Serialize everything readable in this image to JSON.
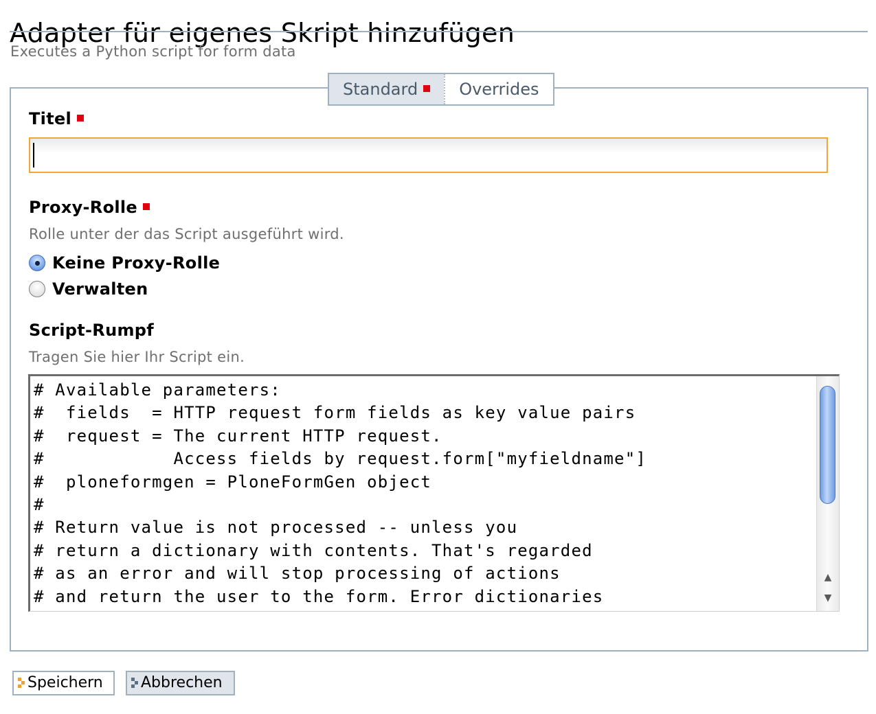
{
  "page": {
    "title": "Adapter für eigenes Skript hinzufügen",
    "description": "Executes a Python script for form data"
  },
  "tabs": [
    {
      "label": "Standard",
      "selected": true,
      "required": true
    },
    {
      "label": "Overrides",
      "selected": false
    }
  ],
  "fields": {
    "title": {
      "label": "Titel",
      "required": true,
      "value": ""
    },
    "proxy_role": {
      "label": "Proxy-Rolle",
      "required": true,
      "help": "Rolle unter der das Script ausgeführt wird.",
      "options": [
        {
          "label": "Keine Proxy-Rolle",
          "checked": true
        },
        {
          "label": "Verwalten",
          "checked": false
        }
      ]
    },
    "script_body": {
      "label": "Script-Rumpf",
      "help": "Tragen Sie hier Ihr Script ein.",
      "value": "# Available parameters:\n#  fields  = HTTP request form fields as key value pairs\n#  request = The current HTTP request.\n#            Access fields by request.form[\"myfieldname\"]\n#  ploneformgen = PloneFormGen object\n#\n# Return value is not processed -- unless you\n# return a dictionary with contents. That's regarded\n# as an error and will stop processing of actions\n# and return the user to the form. Error dictionaries"
    }
  },
  "buttons": {
    "save": "Speichern",
    "cancel": "Abbrechen"
  },
  "colors": {
    "required_marker": "#e2000f",
    "focus_border": "#f1a63a",
    "frame_border": "#9fb1c0",
    "tab_selected_bg": "#dfe5ea",
    "scroll_thumb": "#6d9ce3"
  }
}
